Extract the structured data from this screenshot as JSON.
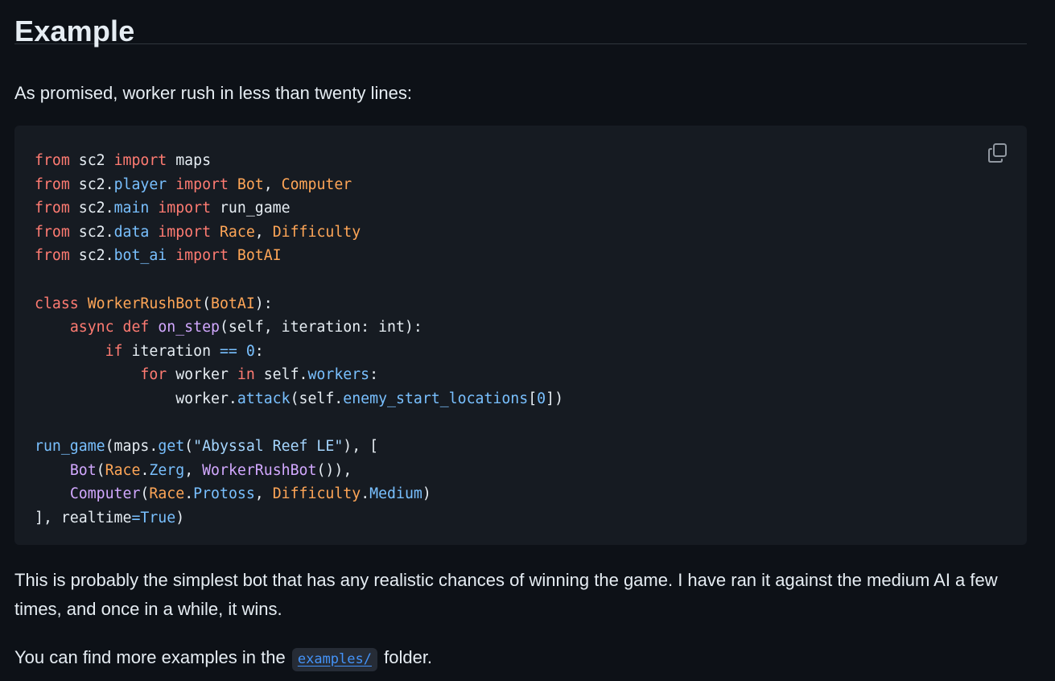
{
  "heading": "Example",
  "intro": "As promised, worker rush in less than twenty lines:",
  "code_block": {
    "copy_icon": "copy-icon",
    "lines": [
      "from sc2 import maps",
      "from sc2.player import Bot, Computer",
      "from sc2.main import run_game",
      "from sc2.data import Race, Difficulty",
      "from sc2.bot_ai import BotAI",
      "",
      "class WorkerRushBot(BotAI):",
      "    async def on_step(self, iteration: int):",
      "        if iteration == 0:",
      "            for worker in self.workers:",
      "                worker.attack(self.enemy_start_locations[0])",
      "",
      "run_game(maps.get(\"Abyssal Reef LE\"), [",
      "    Bot(Race.Zerg, WorkerRushBot()),",
      "    Computer(Race.Protoss, Difficulty.Medium)",
      "], realtime=True)"
    ]
  },
  "paragraph1": "This is probably the simplest bot that has any realistic chances of winning the game. I have ran it against the medium AI a few times, and once in a while, it wins.",
  "paragraph2": {
    "before": "You can find more examples in the",
    "link": "examples/",
    "after": "folder."
  },
  "colors": {
    "background": "#0d1117",
    "code_background": "#161b22",
    "keyword": "#ff7b72",
    "class_name": "#ffa657",
    "function": "#d2a8ff",
    "constant": "#79c0ff",
    "string": "#a5d6ff",
    "link": "#4493f8"
  }
}
